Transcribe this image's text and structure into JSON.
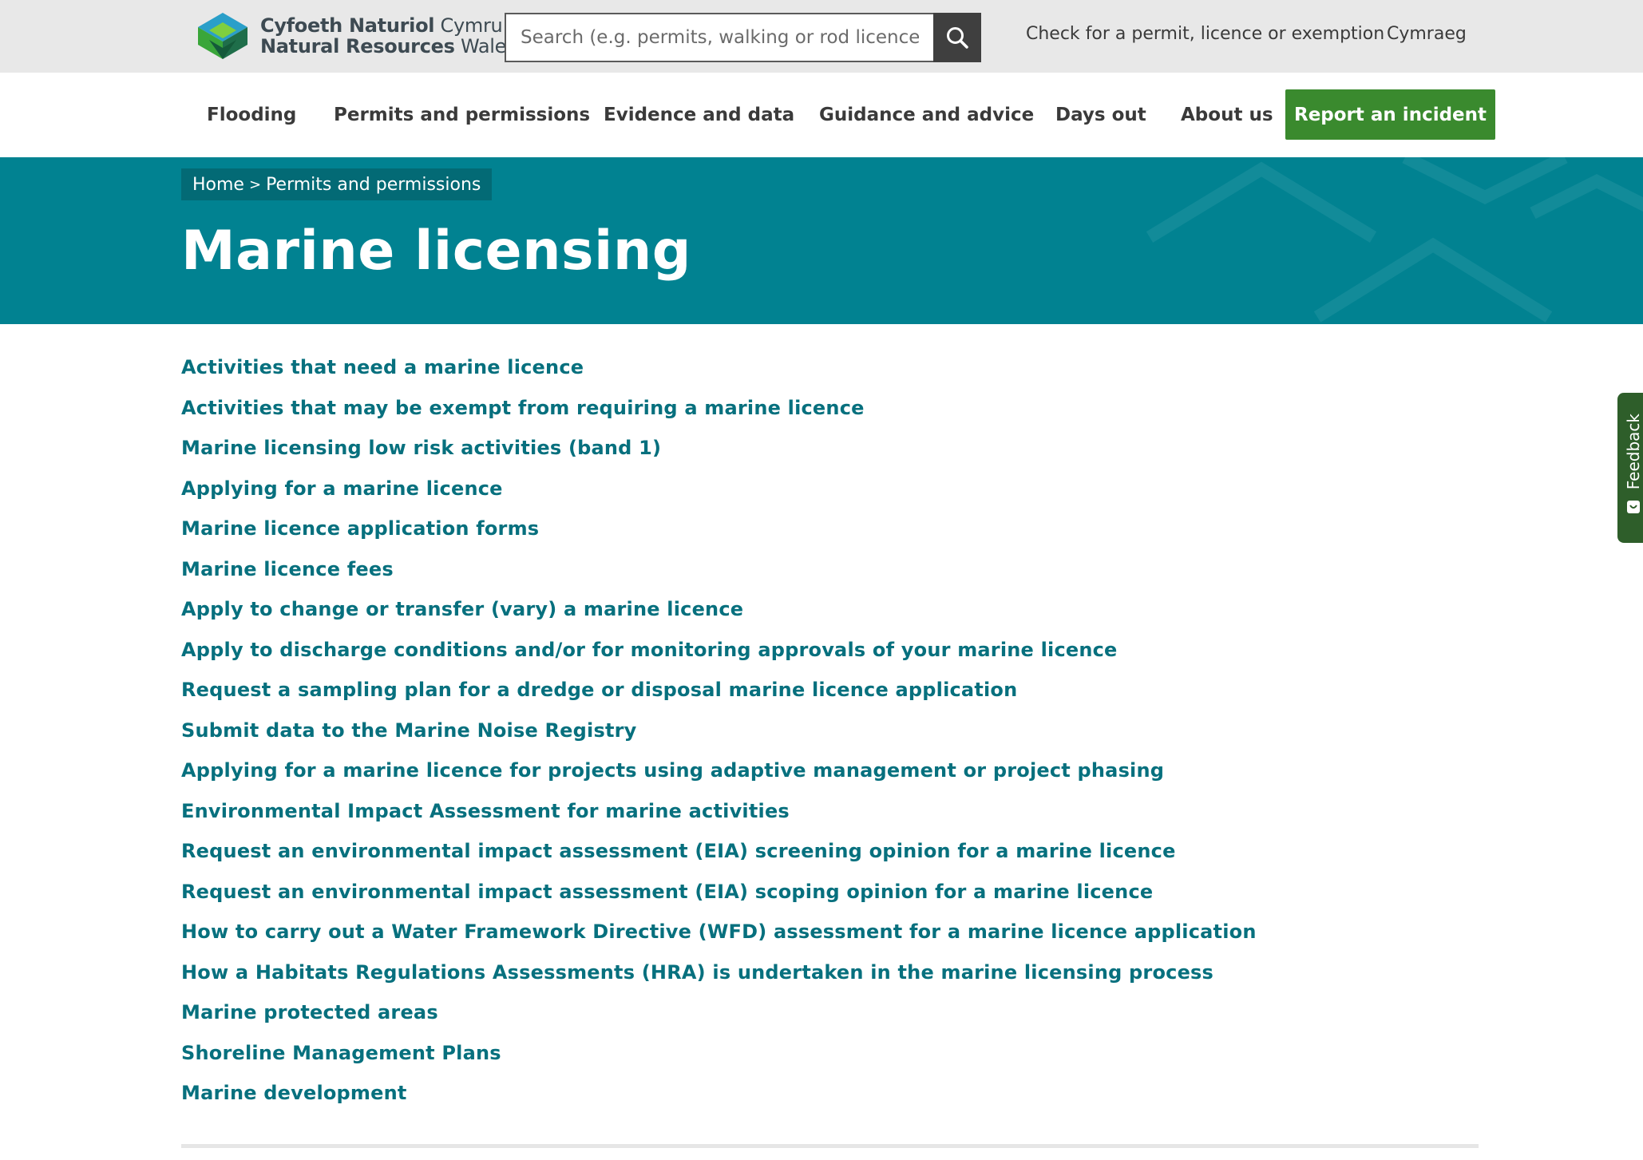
{
  "header": {
    "logo": {
      "line1_bold": "Cyfoeth Naturiol",
      "line1_rest": " Cymru",
      "line2_bold": "Natural Resources",
      "line2_rest": " Wales"
    },
    "search": {
      "placeholder": "Search (e.g. permits, walking or rod licence",
      "value": ""
    },
    "search_icon": "search-icon",
    "utility_links": [
      "Check for a permit, licence or exemption",
      "Cymraeg"
    ]
  },
  "nav": {
    "items": [
      "Flooding",
      "Permits and permissions",
      "Evidence and data",
      "Guidance and advice",
      "Days out",
      "About us"
    ],
    "report_button": "Report an incident"
  },
  "hero": {
    "breadcrumb": [
      "Home",
      "Permits and permissions"
    ],
    "breadcrumb_separator": ">",
    "title": "Marine licensing"
  },
  "links": [
    "Activities that need a marine licence",
    "Activities that may be exempt from requiring a marine licence",
    "Marine licensing low risk activities (band 1)",
    "Applying for a marine licence",
    "Marine licence application forms",
    "Marine licence fees",
    "Apply to change or transfer (vary) a marine licence",
    "Apply to discharge conditions and/or for monitoring approvals of your marine licence",
    "Request a sampling plan for a dredge or disposal marine licence application",
    "Submit data to the Marine Noise Registry",
    "Applying for a marine licence for projects using adaptive management or project phasing",
    "Environmental Impact Assessment for marine activities",
    "Request an environmental impact assessment (EIA) screening opinion for a marine licence",
    "Request an environmental impact assessment (EIA) scoping opinion for a marine licence",
    "How to carry out a Water Framework Directive (WFD) assessment for a marine licence application",
    "How a Habitats Regulations Assessments (HRA) is undertaken in the marine licensing process",
    "Marine protected areas",
    "Shoreline Management Plans",
    "Marine development"
  ],
  "feedback": {
    "label": "Feedback",
    "icon": "feedback-icon"
  },
  "colors": {
    "topbar_bg": "#e8e8e8",
    "hero_bg": "#018291",
    "breadcrumb_bg": "#036a75",
    "link": "#07707e",
    "report_button_bg": "#3a8a2e",
    "feedback_bg": "#2e5e2a"
  }
}
